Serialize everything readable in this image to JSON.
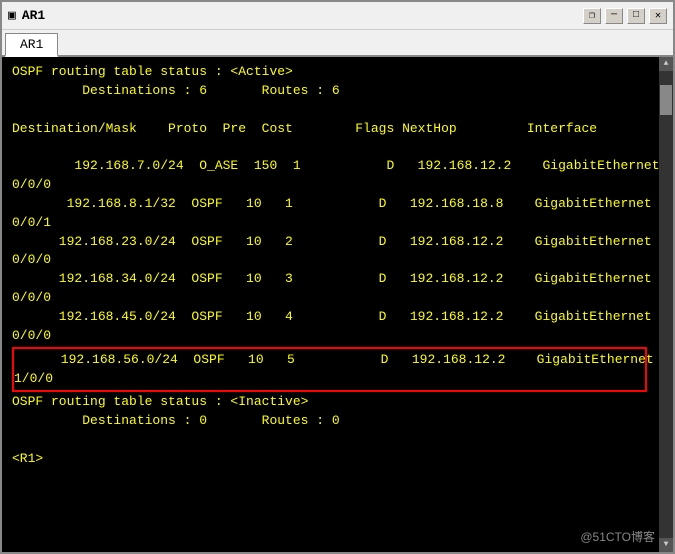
{
  "window": {
    "title": "AR1",
    "tab": "AR1"
  },
  "controls": {
    "restore": "❐",
    "minimize": "─",
    "maximize": "□",
    "close": "✕"
  },
  "terminal": {
    "lines": [
      "",
      "OSPF routing table status : <Active>",
      "         Destinations : 6       Routes : 6",
      "",
      "Destination/Mask    Proto  Pre  Cost        Flags NextHop         Interface",
      "",
      "        192.168.7.0/24  O_ASE  150  1           D   192.168.12.2    GigabitEthernet",
      "0/0/0",
      "       192.168.8.1/32  OSPF   10   1           D   192.168.18.8    GigabitEthernet",
      "0/0/1",
      "      192.168.23.0/24  OSPF   10   2           D   192.168.12.2    GigabitEthernet",
      "0/0/0",
      "      192.168.34.0/24  OSPF   10   3           D   192.168.12.2    GigabitEthernet",
      "0/0/0",
      "      192.168.45.0/24  OSPF   10   4           D   192.168.12.2    GigabitEthernet",
      "0/0/0"
    ],
    "highlighted": {
      "line1": "      192.168.56.0/24  OSPF   10   5           D   192.168.12.2    GigabitEthernet",
      "line2": "1/0/0"
    },
    "after_lines": [
      "",
      "OSPF routing table status : <Inactive>",
      "         Destinations : 0       Routes : 0",
      ""
    ],
    "prompt": "<R1>",
    "watermark": "@51CTO博客"
  }
}
